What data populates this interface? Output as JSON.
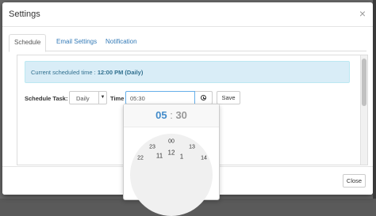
{
  "modal": {
    "title": "Settings",
    "close_symbol": "×"
  },
  "tabs": [
    {
      "label": "Schedule",
      "active": true
    },
    {
      "label": "Email Settings",
      "active": false
    },
    {
      "label": "Notification",
      "active": false
    }
  ],
  "alert": {
    "prefix": "Current scheduled time :",
    "value": "12:00 PM (Daily)"
  },
  "form": {
    "schedule_label": "Schedule Task:",
    "schedule_value": "Daily",
    "time_label": "Time",
    "time_value": "05:30",
    "clock_icon": "clock-icon",
    "save_label": "Save"
  },
  "clockpicker": {
    "hours": "05",
    "separator": ":",
    "minutes": "30",
    "dial_outer": [
      "00",
      "13",
      "14",
      "23",
      "22"
    ],
    "dial_inner": [
      "12",
      "11",
      "1"
    ]
  },
  "footer": {
    "close_label": "Close"
  }
}
